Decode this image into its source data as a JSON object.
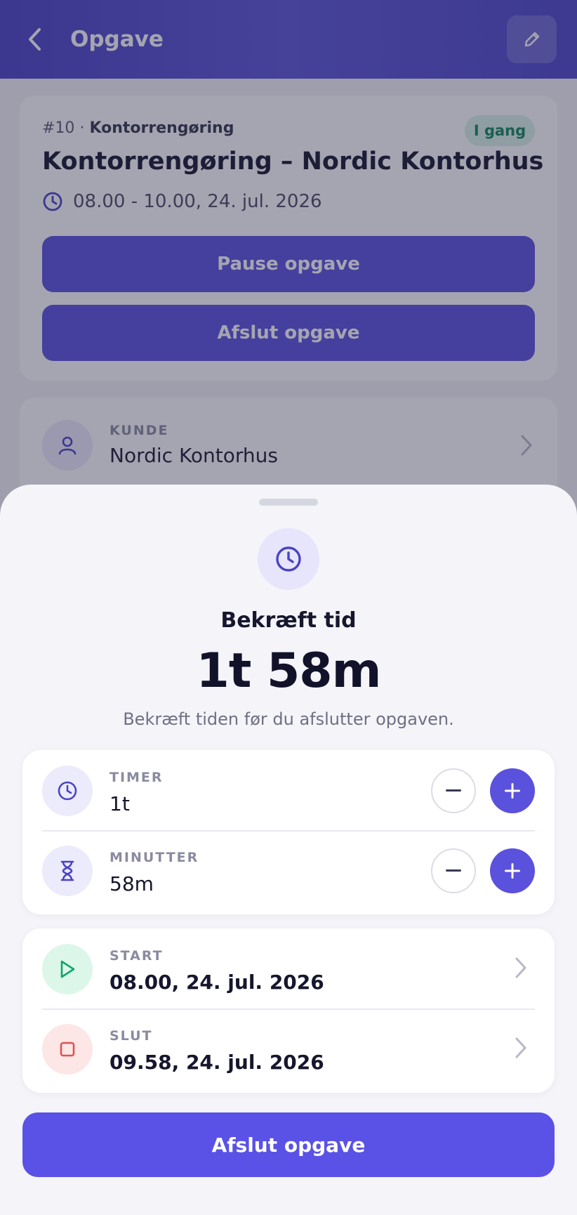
{
  "header": {
    "title": "Opgave",
    "back_icon": "chevron-left-icon",
    "edit_icon": "pencil-icon"
  },
  "task": {
    "number": "#10",
    "separator": "·",
    "category": "Kontorrengøring",
    "status": "I gang",
    "title": "Kontorrengøring – Nordic Kontorhus",
    "time_range": "08.00 - 10.00, 24. jul. 2026",
    "pause_label": "Pause opgave",
    "finish_label": "Afslut opgave"
  },
  "customer": {
    "label": "KUNDE",
    "name": "Nordic Kontorhus"
  },
  "sheet": {
    "title": "Bekræft tid",
    "total": "1t 58m",
    "subtitle": "Bekræft tiden før du afslutter opgaven.",
    "hours": {
      "label": "TIMER",
      "value": "1t",
      "minus": "−",
      "plus": "+"
    },
    "minutes": {
      "label": "MINUTTER",
      "value": "58m",
      "minus": "−",
      "plus": "+"
    },
    "start": {
      "label": "START",
      "value": "08.00, 24. jul. 2026"
    },
    "end": {
      "label": "SLUT",
      "value": "09.58, 24. jul. 2026"
    },
    "confirm_label": "Afslut opgave"
  },
  "colors": {
    "accent": "#5a52dc",
    "header": "#4b43c4",
    "status_bg": "#d8f3e6",
    "status_text": "#12855a",
    "start_icon": "#12a56b",
    "end_icon": "#e05252"
  }
}
